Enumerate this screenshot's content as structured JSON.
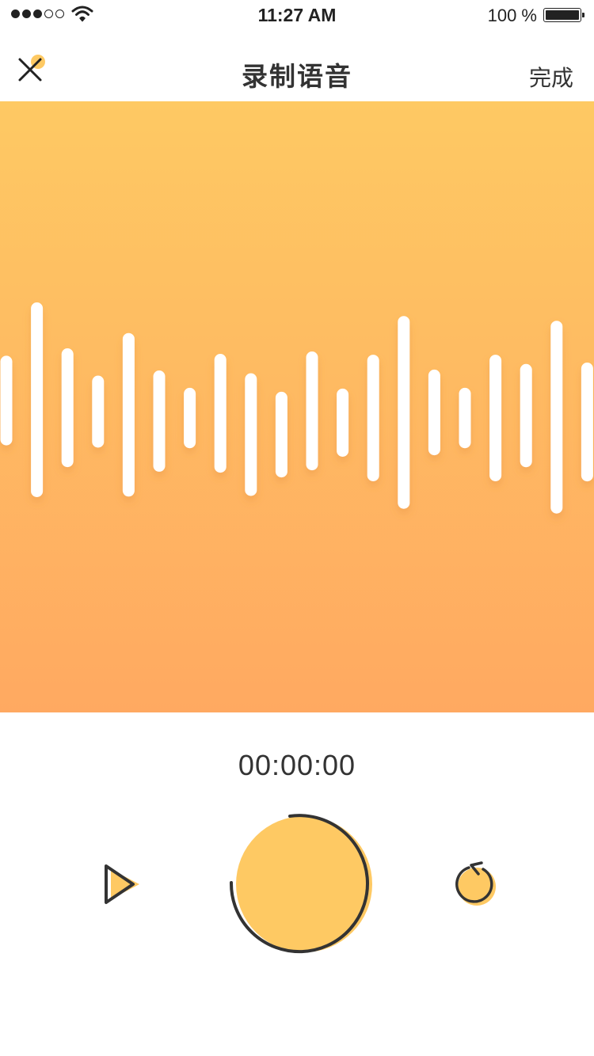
{
  "status_bar": {
    "time": "11:27 AM",
    "battery_text": "100 %",
    "signal_bars_filled": 3,
    "signal_bars_total": 5
  },
  "nav": {
    "title": "录制语音",
    "done_label": "完成",
    "close_icon": "close-icon"
  },
  "waveform": {
    "bar_color": "#ffffff",
    "gradient_top": "#fec963",
    "gradient_bottom": "#ffa961",
    "levels": [
      0.46,
      1.0,
      0.61,
      0.37,
      0.84,
      0.52,
      0.31,
      0.61,
      0.63,
      0.44,
      0.61,
      0.35,
      0.65,
      0.99,
      0.44,
      0.31,
      0.65,
      0.53,
      0.99,
      0.61
    ]
  },
  "timer": {
    "value": "00:00:00"
  },
  "controls": {
    "accent": "#fec963",
    "stroke": "#333333",
    "play_icon": "play-icon",
    "record_icon": "record-icon",
    "reset_icon": "reset-icon"
  }
}
